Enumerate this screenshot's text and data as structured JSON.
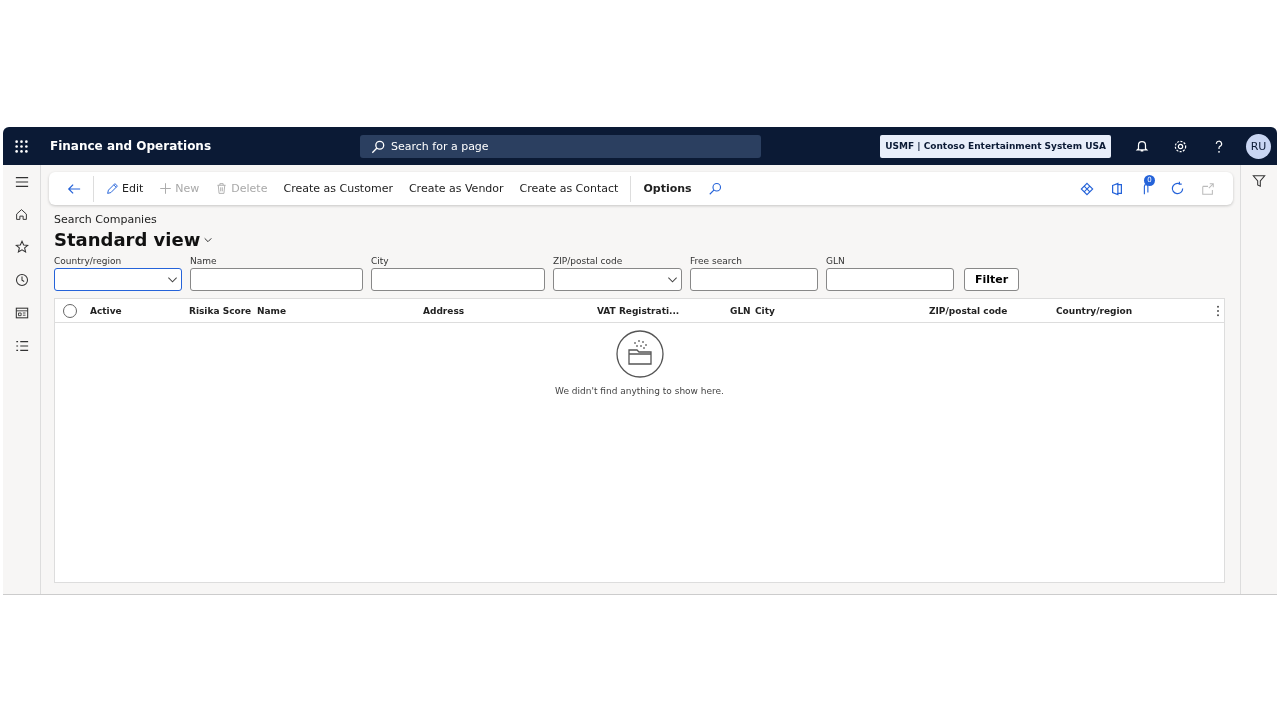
{
  "header": {
    "app_title": "Finance and Operations",
    "search": {
      "placeholder": "Search for a page"
    },
    "company": "USMF | Contoso Entertainment System USA",
    "avatar": "RU"
  },
  "toolbar": {
    "items": [
      {
        "kind": "edit",
        "label": "Edit",
        "disabled": false
      },
      {
        "kind": "new",
        "label": "New",
        "disabled": true
      },
      {
        "kind": "delete",
        "label": "Delete",
        "disabled": true
      },
      {
        "kind": "plain",
        "label": "Create as Customer",
        "disabled": false
      },
      {
        "kind": "plain",
        "label": "Create as Vendor",
        "disabled": false
      },
      {
        "kind": "plain",
        "label": "Create as Contact",
        "disabled": false
      },
      {
        "kind": "options",
        "label": "Options",
        "disabled": false
      }
    ],
    "badge": "0"
  },
  "breadcrumb": "Search Companies",
  "view_title": "Standard view",
  "filters": [
    {
      "label": "Country/region",
      "kind": "select",
      "focused": true
    },
    {
      "label": "Name",
      "kind": "text",
      "focused": false
    },
    {
      "label": "City",
      "kind": "text",
      "focused": false
    },
    {
      "label": "ZIP/postal code",
      "kind": "select",
      "focused": false
    },
    {
      "label": "Free search",
      "kind": "text",
      "focused": false
    },
    {
      "label": "GLN",
      "kind": "text",
      "focused": false
    }
  ],
  "filter_button": "Filter",
  "table": {
    "select_all_checked": false,
    "columns": [
      "Active",
      "Risika Score",
      "Name",
      "Address",
      "VAT Registrati...",
      "GLN",
      "City",
      "ZIP/postal code",
      "Country/region"
    ],
    "empty_message": "We didn't find anything to show here."
  }
}
